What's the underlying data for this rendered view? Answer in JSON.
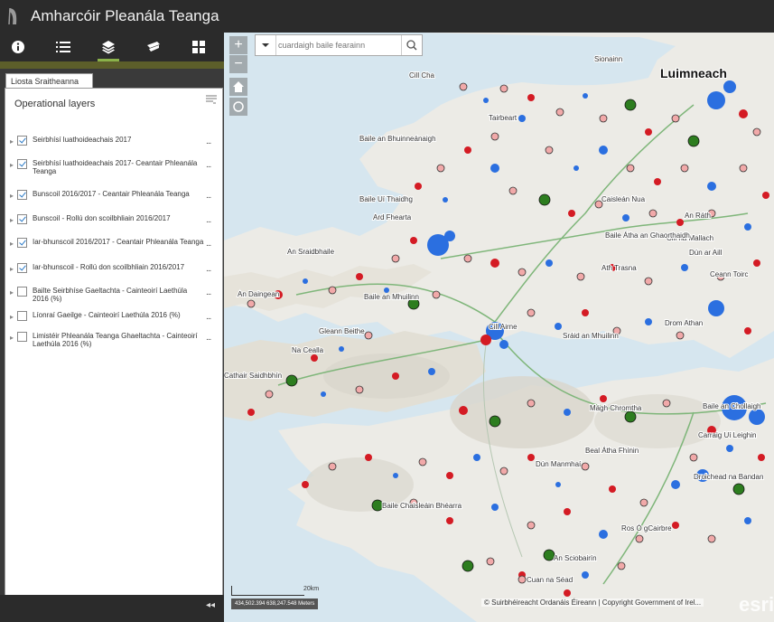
{
  "app": {
    "title": "Amharcóir Pleanála Teanga"
  },
  "toolbar": {
    "tools": [
      {
        "name": "about",
        "icon": "info-icon"
      },
      {
        "name": "legend",
        "icon": "list-icon"
      },
      {
        "name": "layers",
        "icon": "layers-icon"
      },
      {
        "name": "basemap",
        "icon": "basemap-icon"
      },
      {
        "name": "gallery",
        "icon": "grid-icon"
      }
    ],
    "active_index": 2
  },
  "panel": {
    "tab_label": "Liosta Sraitheanna",
    "heading": "Operational layers",
    "layers": [
      {
        "label": "Seirbhísí luathoideachais 2017",
        "checked": true
      },
      {
        "label": "Seirbhísí luathoideachais 2017- Ceantair Phleanála Teanga",
        "checked": true
      },
      {
        "label": "Bunscoil 2016/2017 - Ceantair Phleanála Teanga",
        "checked": true
      },
      {
        "label": "Bunscoil - Rollú don scoilbhliain 2016/2017",
        "checked": true
      },
      {
        "label": "Iar-bhunscoil 2016/2017 - Ceantair Phleanála Teanga",
        "checked": true
      },
      {
        "label": "Iar-bhunscoil - Rollú don scoilbhliain 2016/2017",
        "checked": true
      },
      {
        "label": "Bailte Seirbhíse Gaeltachta - Cainteoirí Laethúla 2016 (%)",
        "checked": false
      },
      {
        "label": "Líonraí Gaeilge - Cainteoirí Laethúla 2016 (%)",
        "checked": false
      },
      {
        "label": "Limistéir Phleanála Teanga Ghaeltachta - Cainteoirí Laethúla 2016 (%)",
        "checked": false
      }
    ],
    "more_label": "...",
    "collapse_label": "◂◂"
  },
  "map": {
    "search": {
      "placeholder": "cuardaigh baile fearainn"
    },
    "zoom_in": "+",
    "zoom_out": "−",
    "scale_label": "20km",
    "coordinates": "434,502.394 638,247.548 Meters",
    "attribution": "© Suirbhéireacht Ordanáis Éireann | Copyright Government of Irel...",
    "esri_label": "esri",
    "places": [
      {
        "name": "Luimneach",
        "big": true
      },
      {
        "name": "Cill Cha"
      },
      {
        "name": "Sionainn"
      },
      {
        "name": "Baile an Bhuinneánaigh"
      },
      {
        "name": "Tairbeart"
      },
      {
        "name": "Baile Uí Thaidhg"
      },
      {
        "name": "Ard Fhearta"
      },
      {
        "name": "An Sraidbhaile"
      },
      {
        "name": "An Daingean"
      },
      {
        "name": "Baile an Mhuilinn"
      },
      {
        "name": "Gleann Beithe"
      },
      {
        "name": "Na Cealla"
      },
      {
        "name": "Cathair Saidhbhín"
      },
      {
        "name": "Cill Airne"
      },
      {
        "name": "Caisleán Nua"
      },
      {
        "name": "An Ráth"
      },
      {
        "name": "Dún Manmhaí"
      },
      {
        "name": "Baile Chaisleáin Bhéarra"
      },
      {
        "name": "An Sciobairín"
      },
      {
        "name": "Cuan na Séad"
      },
      {
        "name": "Ceann Toirc"
      },
      {
        "name": "Baile an Chollaigh"
      },
      {
        "name": "Carraig Uí Leighin"
      },
      {
        "name": "Beal Átha Fhínin"
      },
      {
        "name": "Droichead na Bandan"
      },
      {
        "name": "Mágh Chromtha"
      },
      {
        "name": "Drom Athan"
      },
      {
        "name": "Sráid an Mhuilinn"
      },
      {
        "name": "Cill na Mallach"
      },
      {
        "name": "Dún ar Aill"
      },
      {
        "name": "Ros Ó gCairbre"
      },
      {
        "name": "Ath Trasna"
      },
      {
        "name": "Baile Átha an Ghaorthaidh"
      }
    ]
  },
  "colors": {
    "title_bar": "#2b2b2b",
    "active_tab_underline": "#8ab24a",
    "panel_strip": "#5c5e2a",
    "water": "#d6e6ef",
    "land": "#ecebe6",
    "symbol_red": "#d41b24",
    "symbol_pink": "#f1a9a9",
    "symbol_blue": "#2b6fe0",
    "symbol_green": "#2d7d1f"
  }
}
